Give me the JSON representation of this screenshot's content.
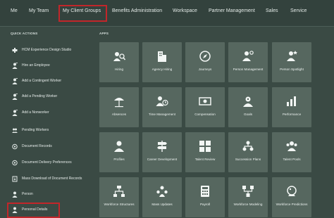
{
  "nav": {
    "tabs": [
      "Me",
      "My Team",
      "My Client Groups",
      "Benefits Administration",
      "Workspace",
      "Partner Management",
      "Sales",
      "Service"
    ]
  },
  "quick_actions": {
    "heading": "QUICK ACTIONS",
    "items": [
      {
        "label": "HCM Experience Design Studio",
        "icon": "tools-icon"
      },
      {
        "label": "Hire an Employee",
        "icon": "person-add-icon"
      },
      {
        "label": "Add a Contingent Worker",
        "icon": "person-add-icon"
      },
      {
        "label": "Add a Pending Worker",
        "icon": "person-add-icon"
      },
      {
        "label": "Add a Nonworker",
        "icon": "person-add-icon"
      },
      {
        "label": "Pending Workers",
        "icon": "people-icon"
      },
      {
        "label": "Document Records",
        "icon": "document-icon"
      },
      {
        "label": "Document Delivery Preferences",
        "icon": "document-icon"
      },
      {
        "label": "Mass Download of Document Records",
        "icon": "download-icon"
      },
      {
        "label": "Person",
        "icon": "person-icon"
      },
      {
        "label": "Personal Details",
        "icon": "person-icon"
      }
    ]
  },
  "apps": {
    "heading": "APPS",
    "tiles": [
      {
        "label": "Hiring",
        "icon": "hiring-icon"
      },
      {
        "label": "Agency Hiring",
        "icon": "building-icon"
      },
      {
        "label": "Journeys",
        "icon": "compass-icon"
      },
      {
        "label": "Person Management",
        "icon": "person-gear-icon"
      },
      {
        "label": "Person Spotlight",
        "icon": "person-star-icon"
      },
      {
        "label": "Absences",
        "icon": "beach-icon"
      },
      {
        "label": "Time Management",
        "icon": "person-clock-icon"
      },
      {
        "label": "Compensation",
        "icon": "money-icon"
      },
      {
        "label": "Goals",
        "icon": "target-icon"
      },
      {
        "label": "Performance",
        "icon": "chart-icon"
      },
      {
        "label": "Profiles",
        "icon": "profile-icon"
      },
      {
        "label": "Career Development",
        "icon": "signpost-icon"
      },
      {
        "label": "Talent Review",
        "icon": "grid-icon"
      },
      {
        "label": "Succession Plans",
        "icon": "org-icon"
      },
      {
        "label": "Talent Pools",
        "icon": "people-group-icon"
      },
      {
        "label": "Workforce Structures",
        "icon": "hierarchy-icon"
      },
      {
        "label": "Mass Updates",
        "icon": "mass-update-icon"
      },
      {
        "label": "Payroll",
        "icon": "calculator-icon"
      },
      {
        "label": "Workforce Modeling",
        "icon": "modeling-icon"
      },
      {
        "label": "Workforce Predictions",
        "icon": "crystal-ball-icon"
      }
    ]
  }
}
